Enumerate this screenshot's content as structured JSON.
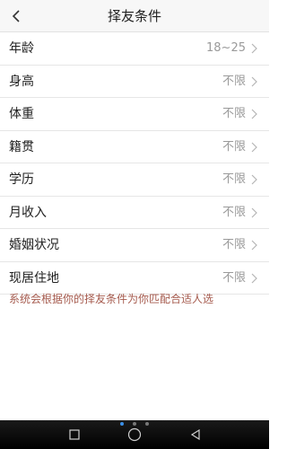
{
  "header": {
    "title": "择友条件",
    "back_icon": "chevron-left-icon"
  },
  "rows": [
    {
      "label": "年龄",
      "value": "18~25"
    },
    {
      "label": "身高",
      "value": "不限"
    },
    {
      "label": "体重",
      "value": "不限"
    },
    {
      "label": "籍贯",
      "value": "不限"
    },
    {
      "label": "学历",
      "value": "不限"
    },
    {
      "label": "月收入",
      "value": "不限"
    },
    {
      "label": "婚姻状况",
      "value": "不限"
    },
    {
      "label": "现居住地",
      "value": "不限"
    }
  ],
  "hint": "系统会根据你的择友条件为你匹配合适人选",
  "colors": {
    "hint": "#a55a4d",
    "accent_dot": "#3a8ee6"
  },
  "system_nav": {
    "icons": [
      "recent-apps-icon",
      "home-icon",
      "back-icon"
    ],
    "page_dots": 3,
    "active_dot": 0
  }
}
